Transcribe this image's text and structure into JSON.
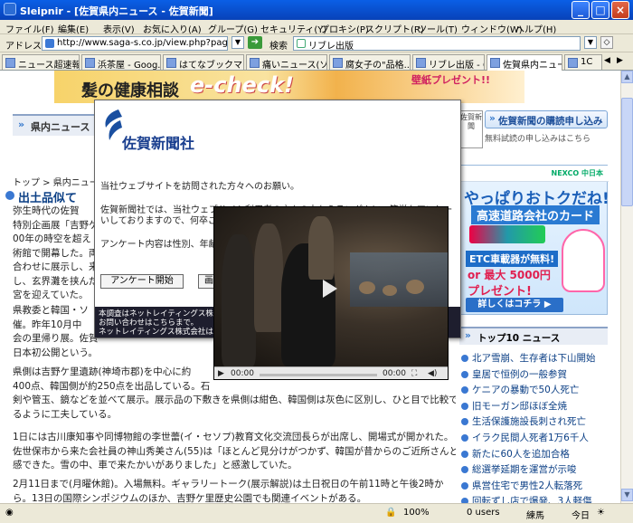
{
  "window": {
    "title": "Sleipnir - [佐賀県内ニュース - 佐賀新聞]"
  },
  "menu": [
    "ファイル(F)",
    "編集(E)",
    "表示(V)",
    "お気に入り(A)",
    "グループ(G)",
    "セキュリティ(Y)",
    "プロキシ(P)",
    "スクリプト(R)",
    "ツール(T)",
    "ウィンドウ(W)",
    "ヘルプ(H)"
  ],
  "address": {
    "label": "アドレス",
    "url": "http://www.saga-s.co.jp/view.php?pageId=",
    "search_label": "検索",
    "search_value": "リブレ出版"
  },
  "tabs": [
    "ニュース超速報...",
    "浜茶屋 - Goog...",
    "はてなブックマー...",
    "痛いニュース(ソ...",
    "腐女子の\"品格...",
    "リブレ出版 - G...",
    "佐賀県内ニュー...",
    "1C"
  ],
  "banner": {
    "text1": "髪の健康相談",
    "text2": "e-check!",
    "text3": "壁紙プレゼント!!"
  },
  "section": {
    "title": "県内ニュース"
  },
  "breadcrumb": "トップ > 県内ニュース",
  "headline": "出土品似て",
  "article": {
    "para1": [
      "弥生時代の佐賀",
      "特別企画展「吉野ケ",
      "00年の時空を超え",
      "術館で開幕した。両",
      "合わせに展示し、来",
      "し、玄界灘を挟んだ",
      "宮を迎えていた。"
    ],
    "para2": [
      "県教委と韓国・ソ",
      "催。昨年10月中",
      "会の里帰り展。佐賀",
      "日本初公開という。"
    ],
    "para3": [
      "県側は吉野ケ里遺跡(神埼市郡)を中心に約",
      "400点、韓国側が約250点を出品している。石",
      "剣や管玉、鏡などを並べて展示。展示品の下敷きを県側は紺色、韓国側は灰色に区別し、ひと目で比較でき",
      "るように工夫している。"
    ],
    "para4": [
      "1日には古川康知事や同博物館の李世蕾(イ・セソプ)教育文化交流団長らが出席し、開場式が開かれた。",
      "佐世保市から来た会社員の神山秀美さん(55)は「ほとんど見分けがつかず、韓国が昔からのご近所さんと実",
      "感できた。雪の中、車で来たかいがありました」と感激していた。"
    ],
    "para5": [
      "2月11日まで(月曜休館)。入場無料。ギャラリートーク(展示解説)は土日祝日の午前11時と午後2時か",
      "ら。13日の国際シンポジウムのほか、吉野ケ里歴史公園でも関連イベントがある。"
    ]
  },
  "sidebar": {
    "seal": "佐賀新聞",
    "subscribe": "佐賀新聞の購読申し込み",
    "trial": "無料試読の申し込みはこちら",
    "etc_badge": "NEXCO 中日本",
    "etc_h1": "やっぱりおトクだね!",
    "etc_h2": "高速道路会社のカード",
    "etc_l1": "ETC車載器が無料!",
    "etc_l2": "or 最大 5000円",
    "etc_l3": "プレゼント!",
    "etc_more": "詳しくはコチラ ▶"
  },
  "top10": {
    "title": "トップ10 ニュース",
    "items": [
      "北ア雪崩、生存者は下山開始",
      "皇居で恒例の一般参賀",
      "ケニアの暴動で50人死亡",
      "旧モーガン邸ほぼ全焼",
      "生活保護施設長刺され死亡",
      "イラク民間人死者1万6千人",
      "新たに60人を追加合格",
      "総選挙延期を運営が示唆",
      "県営住宅で男性2人転落死",
      "回転ずし店で爆発、3人軽傷"
    ]
  },
  "modal": {
    "brand": "佐賀新聞社",
    "greeting": "当社ウェブサイトを訪問された方々へのお願い。",
    "body1": "佐賀新聞社では、当社ウェブサイト利用者の方々の中からランダムに、簡単なアンケートをお願",
    "body2": "いしておりますので、何卒ご協力",
    "body3": "アンケート内容は性別、年齢、",
    "btn_start": "アンケート開始",
    "btn_later": "画面",
    "foot1": "本調査はネットレイティングス株式会社",
    "foot2": "お問い合わせはこちらまで。",
    "foot3": "ネットレイティングス株式会社は日本で"
  },
  "video": {
    "time_left": "00:00",
    "time_right": "00:00"
  },
  "status": {
    "zoom": "100%",
    "users": "0 users",
    "place": "練馬",
    "today": "今日"
  }
}
